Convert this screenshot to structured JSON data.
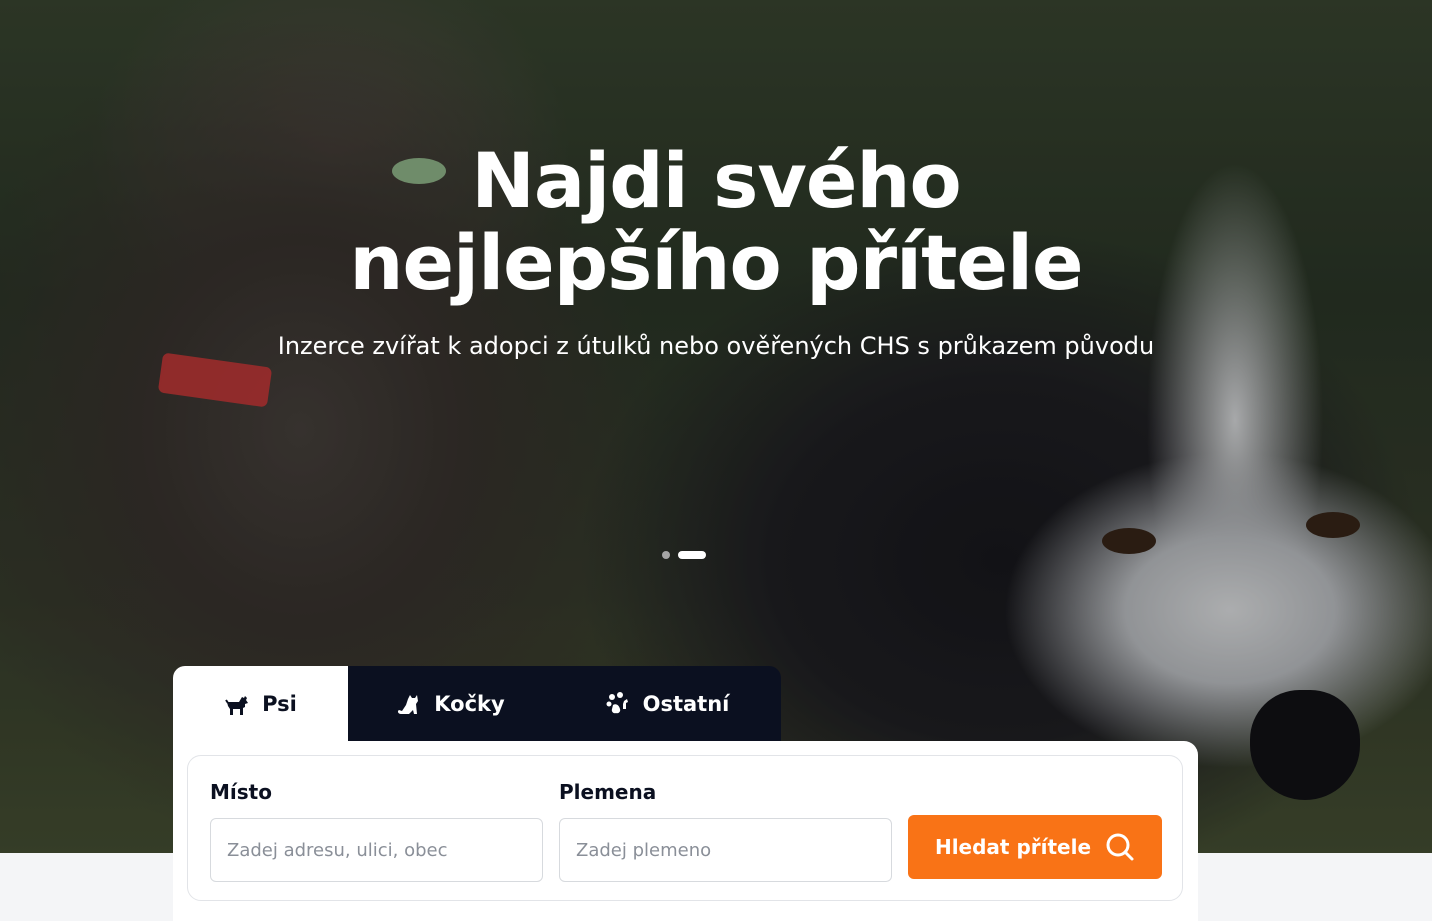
{
  "hero": {
    "title_line1": "Najdi svého",
    "title_line2": "nejlepšího přítele",
    "subtitle": "Inzerce zvířat k adopci z útulků nebo ověřených CHS s průkazem původu",
    "slides": {
      "count": 2,
      "active_index": 1
    }
  },
  "tabs": [
    {
      "label": "Psi",
      "icon": "dog-icon",
      "active": true
    },
    {
      "label": "Kočky",
      "icon": "cat-icon",
      "active": false
    },
    {
      "label": "Ostatní",
      "icon": "paw-animals-icon",
      "active": false
    }
  ],
  "search": {
    "place_label": "Místo",
    "place_placeholder": "Zadej adresu, ulici, obec",
    "breed_label": "Plemena",
    "breed_placeholder": "Zadej plemeno",
    "button_label": "Hledat přítele",
    "button_icon": "search-icon"
  },
  "colors": {
    "accent": "#f97316",
    "dark": "#0b1020",
    "white": "#ffffff"
  }
}
